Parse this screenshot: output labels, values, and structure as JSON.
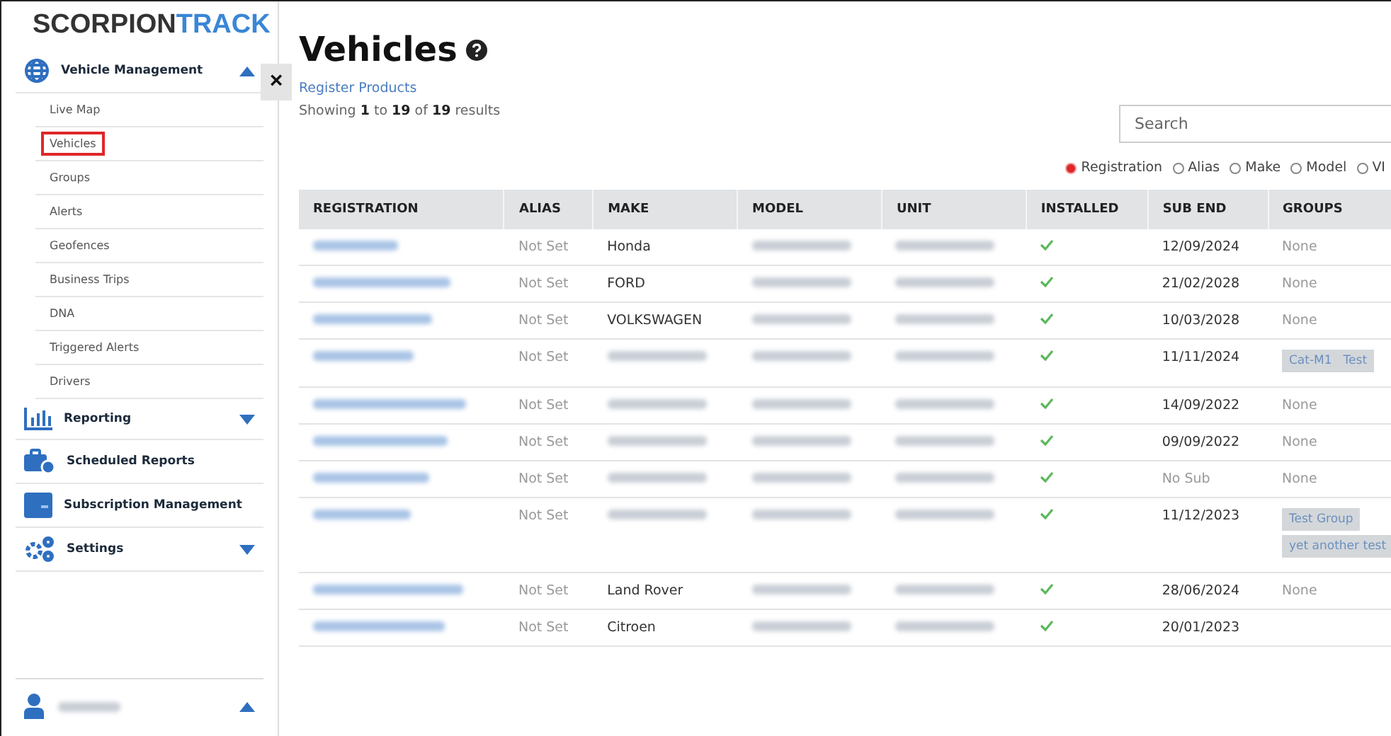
{
  "logo": {
    "part_1": "SCORPION",
    "part_2": "TRACK"
  },
  "sidebar": {
    "items": [
      {
        "kind": "globe",
        "label": "Vehicle Management",
        "expanded": true,
        "children": [
          {
            "label": "Live Map",
            "selected": false
          },
          {
            "label": "Vehicles",
            "selected": true
          },
          {
            "label": "Groups",
            "selected": false
          },
          {
            "label": "Alerts",
            "selected": false
          },
          {
            "label": "Geofences",
            "selected": false
          },
          {
            "label": "Business Trips",
            "selected": false
          },
          {
            "label": "DNA",
            "selected": false
          },
          {
            "label": "Triggered Alerts",
            "selected": false
          },
          {
            "label": "Drivers",
            "selected": false
          }
        ]
      },
      {
        "kind": "chart",
        "label": "Reporting",
        "expanded": false
      },
      {
        "kind": "briefcase",
        "label": "Scheduled Reports"
      },
      {
        "kind": "card",
        "label": "Subscription Management"
      },
      {
        "kind": "gears",
        "label": "Settings",
        "expanded": false
      }
    ],
    "user": {
      "expanded": true
    }
  },
  "close_button": "×",
  "page": {
    "title": "Vehicles",
    "register_link": "Register Products",
    "summary": "Showing **1** to **19** of **19** results",
    "search": {
      "placeholder": "Search"
    },
    "search_by": [
      {
        "label": "Registration",
        "selected": true
      },
      {
        "label": "Alias",
        "selected": false
      },
      {
        "label": "Make",
        "selected": false
      },
      {
        "label": "Model",
        "selected": false
      },
      {
        "label": "VI",
        "selected": false
      }
    ]
  },
  "table": {
    "columns": [
      "REGISTRATION",
      "ALIAS",
      "MAKE",
      "MODEL",
      "UNIT",
      "INSTALLED",
      "SUB END",
      "GROUPS"
    ],
    "rows": [
      {
        "alias": "Not Set",
        "make": "Honda",
        "installed": true,
        "sub_end": "12/09/2024",
        "groups_text": "None"
      },
      {
        "alias": "Not Set",
        "make": "FORD",
        "installed": true,
        "sub_end": "21/02/2028",
        "groups_text": "None"
      },
      {
        "alias": "Not Set",
        "make": "VOLKSWAGEN",
        "installed": true,
        "sub_end": "10/03/2028",
        "groups_text": "None"
      },
      {
        "alias": "Not Set",
        "installed": true,
        "sub_end": "11/11/2024",
        "group_tags": [
          [
            "Cat-M1",
            "Test"
          ]
        ]
      },
      {
        "alias": "Not Set",
        "installed": true,
        "sub_end": "14/09/2022",
        "groups_text": "None"
      },
      {
        "alias": "Not Set",
        "installed": true,
        "sub_end": "09/09/2022",
        "groups_text": "None"
      },
      {
        "alias": "Not Set",
        "installed": true,
        "sub_end": "No Sub",
        "subscribed": false,
        "groups_text": "None"
      },
      {
        "alias": "Not Set",
        "installed": true,
        "sub_end": "11/12/2023",
        "group_tags": [
          [
            "Test Group"
          ],
          [
            "yet another test"
          ]
        ]
      },
      {
        "alias": "Not Set",
        "make": "Land Rover",
        "installed": true,
        "sub_end": "28/06/2024",
        "groups_text": "None"
      },
      {
        "alias": "Not Set",
        "make": "Citroen",
        "installed": true,
        "sub_end": "20/01/2023"
      }
    ]
  }
}
